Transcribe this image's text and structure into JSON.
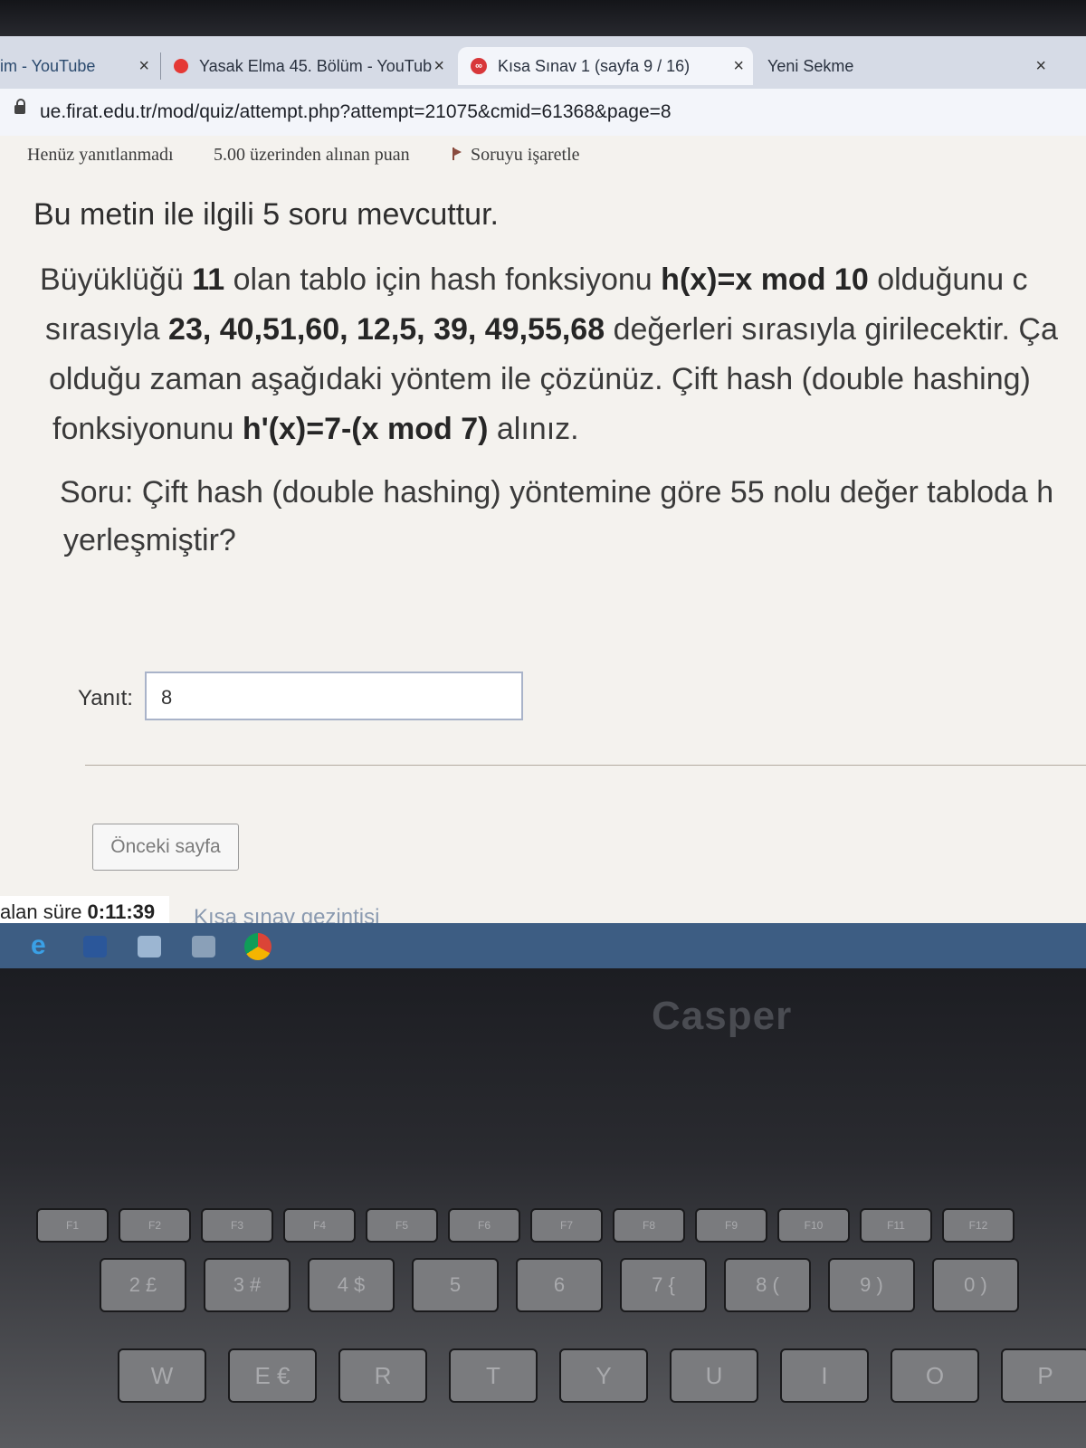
{
  "browser": {
    "tabs": [
      {
        "title": "im - YouTube"
      },
      {
        "title": "Yasak Elma 45. Bölüm - YouTub"
      },
      {
        "title": "Kısa Sınav 1 (sayfa 9 / 16)"
      },
      {
        "title": "Yeni Sekme"
      }
    ],
    "close_glyph": "×",
    "url": "ue.firat.edu.tr/mod/quiz/attempt.php?attempt=21075&cmid=61368&page=8"
  },
  "question_info": {
    "status": "Henüz yanıtlanmadı",
    "points": "5.00 üzerinden alınan puan",
    "flag_label": "Soruyu işaretle"
  },
  "question": {
    "intro": "Bu metin ile ilgili 5 soru mevcuttur.",
    "l1_a": "Büyüklüğü ",
    "l1_b": "11",
    "l1_c": " olan tablo için hash fonksiyonu ",
    "l1_d": "h(x)=x mod 10",
    "l1_e": " olduğunu c",
    "l2_a": "sırasıyla ",
    "l2_b": "23, 40,51,60, 12,5, 39, 49,55,68",
    "l2_c": " değerleri sırasıyla girilecektir. Ça",
    "l3": "olduğu zaman aşağıdaki yöntem ile çözünüz. Çift hash  (double hashing)",
    "l4_a": "fonksiyonunu ",
    "l4_b": "h'(x)=7-(x mod 7)",
    "l4_c": " alınız.",
    "q1": "Soru: Çift hash  (double hashing) yöntemine göre 55 nolu değer tabloda h",
    "q2": "yerleşmiştir?"
  },
  "answer": {
    "label": "Yanıt:",
    "value": "8"
  },
  "navigation": {
    "prev_button": "Önceki sayfa",
    "timer_label": "alan süre",
    "timer_value": "0:11:39",
    "quiz_nav_link": "Kısa sınav gezintisi"
  },
  "taskbar": {
    "icons": [
      "edge-icon",
      "word-icon",
      "photos-icon",
      "mail-icon",
      "chrome-icon"
    ]
  },
  "laptop": {
    "brand": "Casper",
    "keys": [
      "F1",
      "F2",
      "F3",
      "F4",
      "F5",
      "F6",
      "F7",
      "F8",
      "F9",
      "F10",
      "F11",
      "F12",
      "2 £",
      "3 #",
      "4 $",
      "5",
      "6",
      "7 {",
      "8 (",
      "9 )",
      "0 )",
      "W",
      "E €",
      "R",
      "T",
      "Y",
      "U",
      "I",
      "O",
      "P"
    ]
  },
  "colors": {
    "tab_strip": "#d6dbe6",
    "page_bg": "#f4f2ee",
    "taskbar": "#3d5d83",
    "quiz_favicon": "#d8373a"
  }
}
